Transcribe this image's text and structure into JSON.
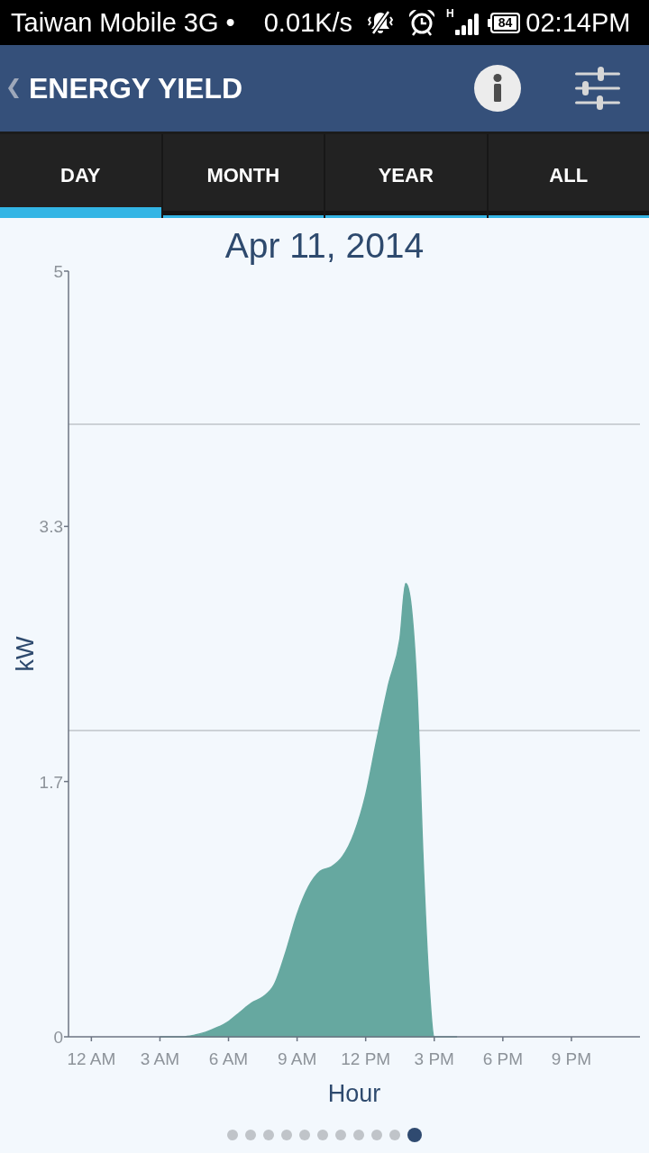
{
  "status_bar": {
    "carrier": "Taiwan Mobile 3G •",
    "data_rate": "0.01K/s",
    "network_type": "H",
    "battery": "84",
    "time": "02:14PM"
  },
  "app_bar": {
    "title": "ENERGY YIELD"
  },
  "tabs": [
    {
      "label": "DAY",
      "selected": true
    },
    {
      "label": "MONTH",
      "selected": false
    },
    {
      "label": "YEAR",
      "selected": false
    },
    {
      "label": "ALL",
      "selected": false
    }
  ],
  "chart": {
    "chart_data": {
      "type": "area",
      "title": "Apr 11, 2014",
      "xlabel": "Hour",
      "ylabel": "kW",
      "x": [
        "2014-04-11T03:00",
        "2014-04-11T04:00",
        "2014-04-11T04:30",
        "2014-04-11T05:00",
        "2014-04-11T05:30",
        "2014-04-11T06:00",
        "2014-04-11T06:30",
        "2014-04-11T07:00",
        "2014-04-11T07:30",
        "2014-04-11T08:00",
        "2014-04-11T08:30",
        "2014-04-11T09:00",
        "2014-04-11T09:30",
        "2014-04-11T10:00",
        "2014-04-11T10:30",
        "2014-04-11T11:00",
        "2014-04-11T11:30",
        "2014-04-11T12:00",
        "2014-04-11T12:30",
        "2014-04-11T13:00",
        "2014-04-11T13:30",
        "2014-04-11T13:45",
        "2014-04-11T14:00",
        "2014-04-11T14:15",
        "2014-04-11T14:30",
        "2014-04-11T14:45",
        "2014-04-11T15:00",
        "2014-04-11T15:30",
        "2014-04-11T16:00"
      ],
      "series": [
        {
          "color": "#66a8a0",
          "values": [
            0,
            0,
            0.01,
            0.03,
            0.06,
            0.1,
            0.16,
            0.22,
            0.26,
            0.34,
            0.55,
            0.8,
            0.98,
            1.08,
            1.11,
            1.18,
            1.33,
            1.58,
            1.95,
            2.3,
            2.6,
            2.96,
            2.8,
            2.25,
            1.2,
            0.4,
            0,
            0,
            0
          ]
        }
      ],
      "xlim": [
        "2014-04-10T23:00",
        "2014-04-12T00:00"
      ],
      "ylim": [
        0,
        5
      ],
      "xticks": [
        {
          "value": "2014-04-11T00:00",
          "label": "12 AM"
        },
        {
          "value": "2014-04-11T03:00",
          "label": "3 AM"
        },
        {
          "value": "2014-04-11T06:00",
          "label": "6 AM"
        },
        {
          "value": "2014-04-11T09:00",
          "label": "9 AM"
        },
        {
          "value": "2014-04-11T12:00",
          "label": "12 PM"
        },
        {
          "value": "2014-04-11T15:00",
          "label": "3 PM"
        },
        {
          "value": "2014-04-11T18:00",
          "label": "6 PM"
        },
        {
          "value": "2014-04-11T21:00",
          "label": "9 PM"
        }
      ],
      "yticks": [
        {
          "value": 0,
          "label": "0"
        },
        {
          "value": 1.667,
          "label": "1.7"
        },
        {
          "value": 3.333,
          "label": "3.3"
        },
        {
          "value": 5,
          "label": "5"
        }
      ],
      "ref_lines": [
        {
          "axis": "y",
          "value": 2
        },
        {
          "axis": "y",
          "value": 4
        }
      ]
    }
  },
  "pager": [
    {
      "selected": false
    },
    {
      "selected": false
    },
    {
      "selected": false
    },
    {
      "selected": false
    },
    {
      "selected": false
    },
    {
      "selected": false
    },
    {
      "selected": false
    },
    {
      "selected": false
    },
    {
      "selected": false
    },
    {
      "selected": false
    },
    {
      "selected": true
    }
  ]
}
